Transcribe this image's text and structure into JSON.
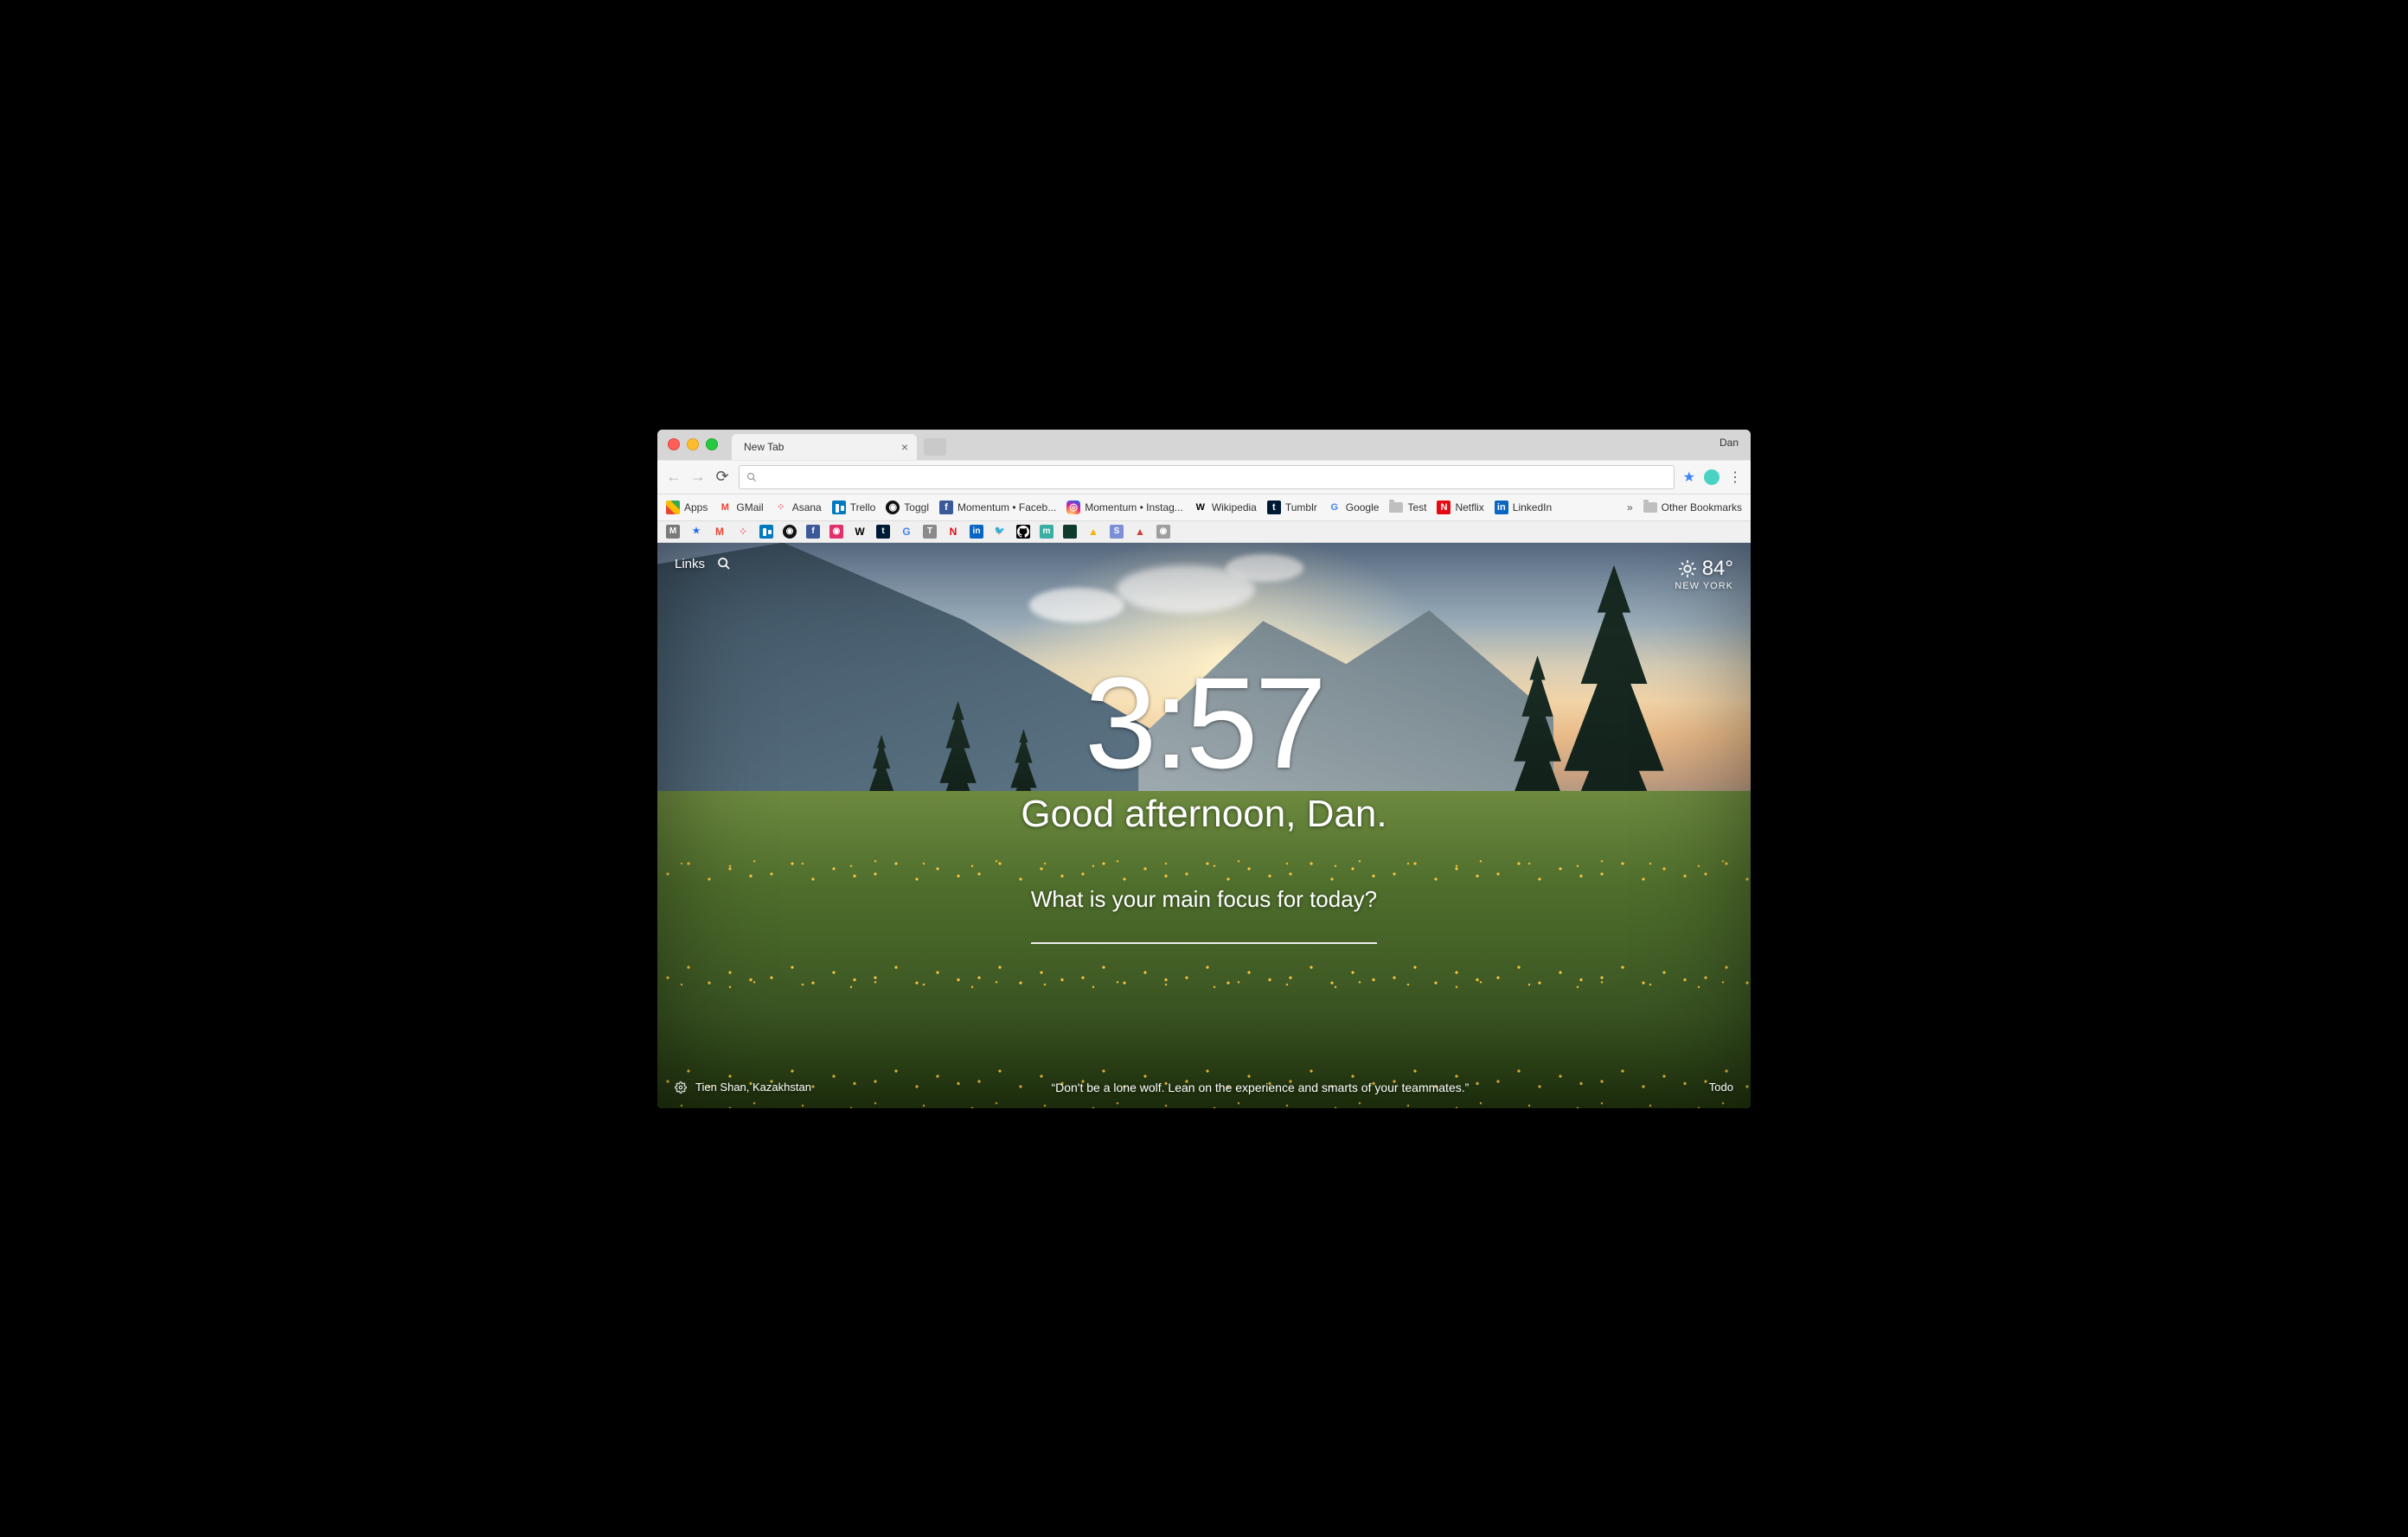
{
  "chrome": {
    "tab_title": "New Tab",
    "profile": "Dan",
    "bookmarks": [
      {
        "label": "Apps",
        "icon": "apps",
        "color": "#fff"
      },
      {
        "label": "GMail",
        "icon": "M",
        "color": "#ea4335"
      },
      {
        "label": "Asana",
        "icon": "asana",
        "color": "#f95d73"
      },
      {
        "label": "Trello",
        "icon": "trello",
        "color": "#0079bf"
      },
      {
        "label": "Toggl",
        "icon": "toggl",
        "color": "#111"
      },
      {
        "label": "Momentum • Faceb...",
        "icon": "f",
        "color": "#3b5998"
      },
      {
        "label": "Momentum • Instag...",
        "icon": "insta",
        "color": "#e1306c"
      },
      {
        "label": "Wikipedia",
        "icon": "W",
        "color": "#000"
      },
      {
        "label": "Tumblr",
        "icon": "t",
        "color": "#001935"
      },
      {
        "label": "Google",
        "icon": "G",
        "color": "#4285f4"
      },
      {
        "label": "Test",
        "icon": "folder",
        "color": "#bfbfbf"
      },
      {
        "label": "Netflix",
        "icon": "N",
        "color": "#e50914"
      },
      {
        "label": "LinkedIn",
        "icon": "in",
        "color": "#0a66c2"
      }
    ],
    "other_bookmarks": "Other Bookmarks",
    "extensions": [
      {
        "name": "medium",
        "glyph": "M",
        "bg": "#7a7a7a",
        "fg": "#fff"
      },
      {
        "name": "star",
        "glyph": "★",
        "bg": "transparent",
        "fg": "#1d6ef2"
      },
      {
        "name": "gmail",
        "glyph": "M",
        "bg": "transparent",
        "fg": "#ea4335"
      },
      {
        "name": "asana",
        "glyph": "⁘",
        "bg": "transparent",
        "fg": "#f95d73"
      },
      {
        "name": "trello",
        "glyph": "",
        "bg": "#0079bf",
        "fg": "#fff"
      },
      {
        "name": "toggl",
        "glyph": "◉",
        "bg": "#111",
        "fg": "#fff"
      },
      {
        "name": "facebook",
        "glyph": "f",
        "bg": "#3b5998",
        "fg": "#fff"
      },
      {
        "name": "instagram",
        "glyph": "◉",
        "bg": "#e1306c",
        "fg": "#fff"
      },
      {
        "name": "wikipedia",
        "glyph": "W",
        "bg": "transparent",
        "fg": "#000"
      },
      {
        "name": "tumblr",
        "glyph": "t",
        "bg": "#001935",
        "fg": "#fff"
      },
      {
        "name": "google",
        "glyph": "G",
        "bg": "transparent",
        "fg": "#4285f4"
      },
      {
        "name": "t2",
        "glyph": "T",
        "bg": "#8a8a8a",
        "fg": "#fff"
      },
      {
        "name": "netflix",
        "glyph": "N",
        "bg": "transparent",
        "fg": "#e50914"
      },
      {
        "name": "linkedin",
        "glyph": "in",
        "bg": "#0a66c2",
        "fg": "#fff"
      },
      {
        "name": "twitter",
        "glyph": "🐦",
        "bg": "transparent",
        "fg": "#1da1f2"
      },
      {
        "name": "github",
        "glyph": "",
        "bg": "#000",
        "fg": "#fff"
      },
      {
        "name": "momentum",
        "glyph": "m",
        "bg": "#3aaea3",
        "fg": "#fff"
      },
      {
        "name": "square",
        "glyph": "",
        "bg": "#0f3b2e",
        "fg": "#fff"
      },
      {
        "name": "drive",
        "glyph": "▲",
        "bg": "transparent",
        "fg": "#f4b400"
      },
      {
        "name": "s",
        "glyph": "S",
        "bg": "#7c8fd6",
        "fg": "#fff"
      },
      {
        "name": "tri",
        "glyph": "▲",
        "bg": "transparent",
        "fg": "#d1403a"
      },
      {
        "name": "cam",
        "glyph": "◉",
        "bg": "#9e9e9e",
        "fg": "#fff"
      }
    ]
  },
  "momentum": {
    "links_label": "Links",
    "weather": {
      "temp": "84°",
      "location": "NEW YORK"
    },
    "time": "3:57",
    "greeting": "Good afternoon, Dan.",
    "focus_prompt": "What is your main focus for today?",
    "photo_location": "Tien Shan, Kazakhstan",
    "quote": "“Don't be a lone wolf. Lean on the experience and smarts of your teammates.”",
    "todo_label": "Todo"
  }
}
